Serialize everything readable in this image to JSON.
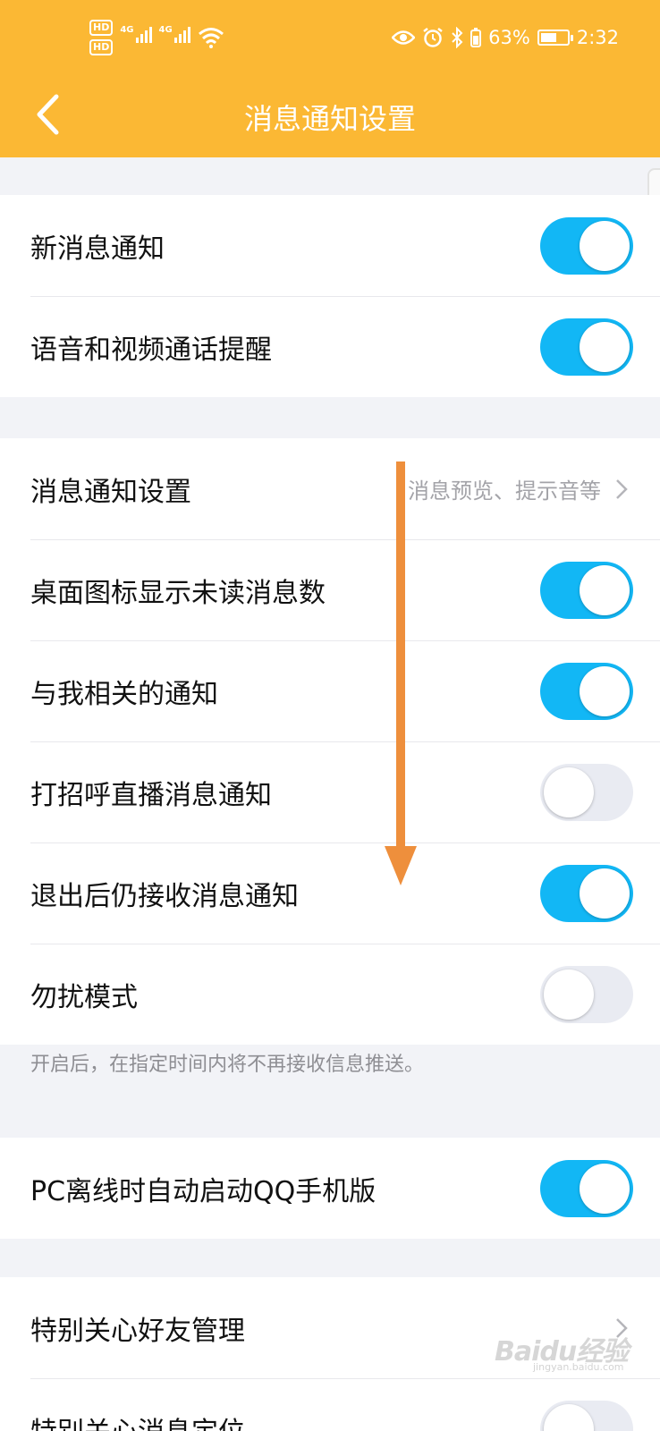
{
  "status_bar": {
    "hd1": "HD",
    "hd2": "HD",
    "net1": "4G",
    "net2": "4G",
    "battery_percent": "63%",
    "battery_level": 0.63,
    "time": "2:32",
    "icons": [
      "eye-icon",
      "alarm-icon",
      "bluetooth-icon",
      "battery-icon",
      "wifi-icon",
      "signal-icon"
    ]
  },
  "header": {
    "title": "消息通知设置",
    "back_icon": "chevron-left-icon",
    "background": "#fbb834"
  },
  "group1": [
    {
      "label": "新消息通知",
      "on": true
    },
    {
      "label": "语音和视频通话提醒",
      "on": true
    }
  ],
  "group2": {
    "notify_settings": {
      "label": "消息通知设置",
      "value": "消息预览、提示音等"
    },
    "toggles": [
      {
        "label": "桌面图标显示未读消息数",
        "on": true
      },
      {
        "label": "与我相关的通知",
        "on": true
      },
      {
        "label": "打招呼直播消息通知",
        "on": false
      },
      {
        "label": "退出后仍接收消息通知",
        "on": true
      },
      {
        "label": "勿扰模式",
        "on": false
      }
    ],
    "note": "开启后，在指定时间内将不再接收信息推送。"
  },
  "group3": [
    {
      "label": "PC离线时自动启动QQ手机版",
      "on": true
    }
  ],
  "group4": [
    {
      "label": "特别关心好友管理"
    },
    {
      "label": "特别关心消息定位"
    }
  ],
  "colors": {
    "toggle_on": "#12b7f5",
    "toggle_off": "#e9ebf2",
    "arrow": "#ee8f3c"
  },
  "watermark": {
    "text": "Baidu经验",
    "sub": "jingyan.baidu.com"
  }
}
